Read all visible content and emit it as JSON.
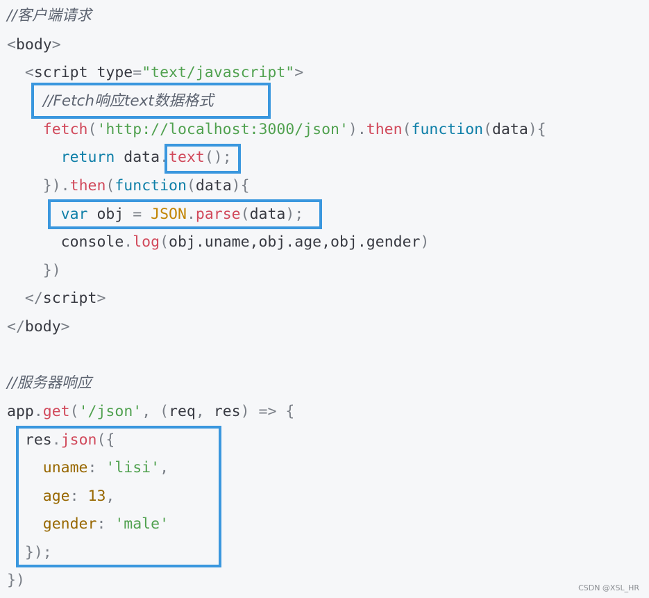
{
  "client_comment": "//客户端请求",
  "code": {
    "body_open": [
      "<",
      "body",
      ">"
    ],
    "script_open_tag": "script",
    "script_attr": "type",
    "script_attr_value": "\"text/javascript\"",
    "fetch_comment": "//Fetch响应text数据格式",
    "fetch_fn": "fetch",
    "fetch_url": "'http://localhost:3000/json'",
    "then1": "then",
    "function_kw": "function",
    "data_param": "data",
    "return_kw": "return",
    "text_method": "text",
    "then2": "then",
    "var_kw": "var",
    "obj_name": "obj",
    "json_obj": "JSON",
    "parse_method": "parse",
    "console_obj": "console",
    "log_method": "log",
    "log_args": "obj.uname,obj.age,obj.gender",
    "close_then": "})",
    "script_close_tag": "script",
    "body_close_tag": "body"
  },
  "server_comment": "//服务器响应",
  "server": {
    "app": "app",
    "get_method": "get",
    "route": "'/json'",
    "req": "req",
    "res": "res",
    "arrow": "=>",
    "json_method": "json",
    "uname_key": "uname",
    "uname_val": "'lisi'",
    "age_key": "age",
    "age_val": "13",
    "gender_key": "gender",
    "gender_val": "'male'",
    "close_json": "});",
    "close_get": "})"
  },
  "watermark": "CSDN @XSL_HR",
  "colors": {
    "highlight_box": "#3a97de",
    "background": "#f6f7f9"
  }
}
